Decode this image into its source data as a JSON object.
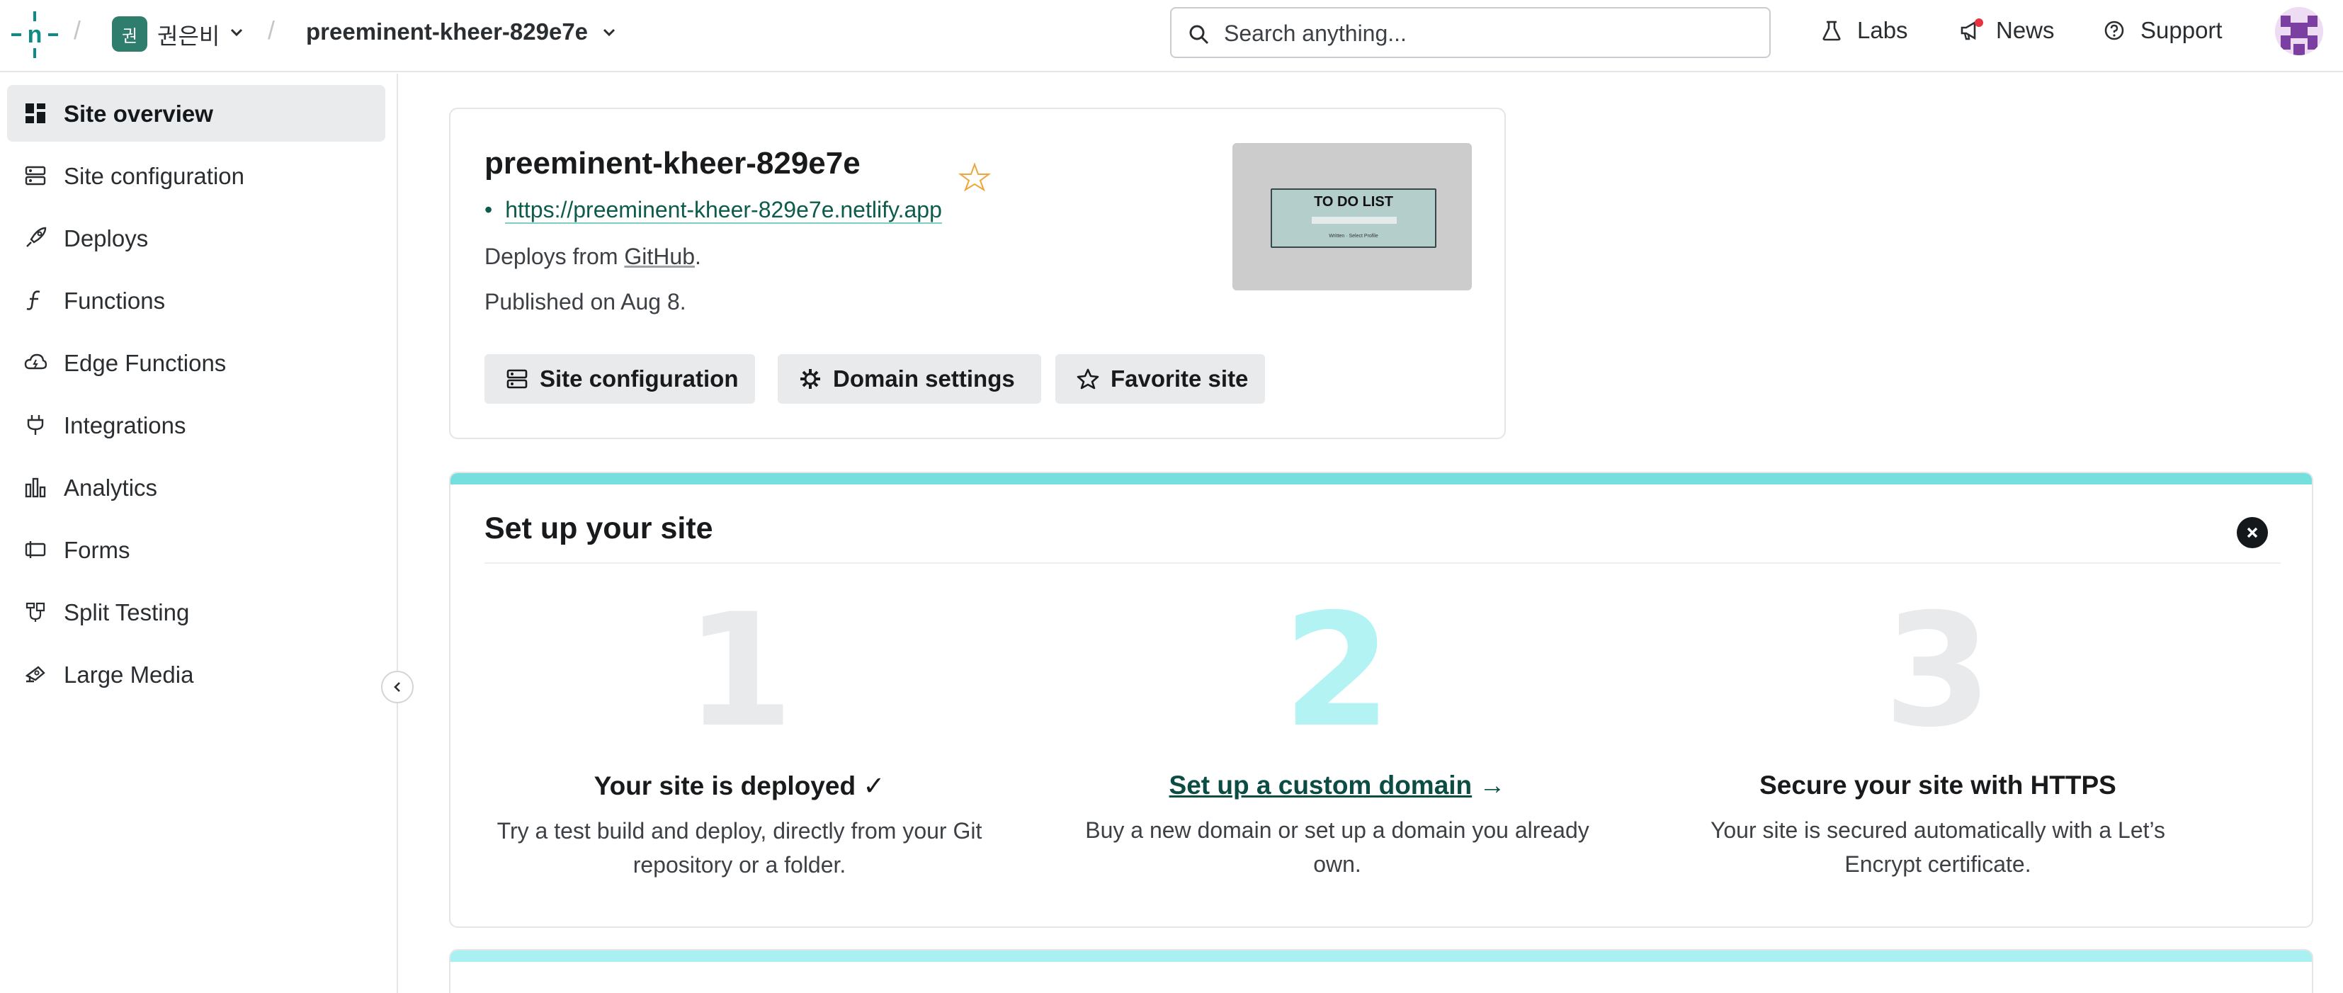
{
  "header": {
    "team": {
      "badge": "권",
      "name": "권은비"
    },
    "site_name": "preeminent-kheer-829e7e",
    "search": {
      "placeholder": "Search anything..."
    },
    "nav": {
      "labs": "Labs",
      "news": "News",
      "support": "Support"
    },
    "colors": {
      "team_badge": "#2f7d6d",
      "news_dot": "#e5333f"
    }
  },
  "sidebar": {
    "items": [
      {
        "label": "Site overview",
        "icon": "grid-icon",
        "active": true
      },
      {
        "label": "Site configuration",
        "icon": "config-icon",
        "active": false
      },
      {
        "label": "Deploys",
        "icon": "rocket-icon",
        "active": false
      },
      {
        "label": "Functions",
        "icon": "function-icon",
        "active": false
      },
      {
        "label": "Edge Functions",
        "icon": "cloud-function-icon",
        "active": false
      },
      {
        "label": "Integrations",
        "icon": "plug-icon",
        "active": false
      },
      {
        "label": "Analytics",
        "icon": "bar-chart-icon",
        "active": false
      },
      {
        "label": "Forms",
        "icon": "form-icon",
        "active": false
      },
      {
        "label": "Split Testing",
        "icon": "split-icon",
        "active": false
      },
      {
        "label": "Large Media",
        "icon": "media-icon",
        "active": false
      }
    ]
  },
  "site_card": {
    "title": "preeminent-kheer-829e7e",
    "url": "https://preeminent-kheer-829e7e.netlify.app",
    "deploys_prefix": "Deploys from ",
    "deploys_source": "GitHub",
    "deploys_suffix": ".",
    "published": "Published on Aug 8.",
    "buttons": {
      "config": "Site configuration",
      "domain": "Domain settings",
      "favorite": "Favorite site"
    },
    "thumbnail": {
      "title": "TO DO LIST",
      "subtitle": "Written · Select Profile"
    }
  },
  "setup": {
    "title": "Set up your site",
    "accent_color": "#74dfdc",
    "steps": [
      {
        "number": "1",
        "heading": "Your site is deployed ✓",
        "description": "Try a test build and deploy, directly from your Git repository or a folder."
      },
      {
        "number": "2",
        "heading": "Set up a custom domain",
        "arrow": "→",
        "description": "Buy a new domain or set up a domain you already own."
      },
      {
        "number": "3",
        "heading": "Secure your site with HTTPS",
        "description": "Your site is secured automatically with a Let’s Encrypt certificate."
      }
    ]
  }
}
